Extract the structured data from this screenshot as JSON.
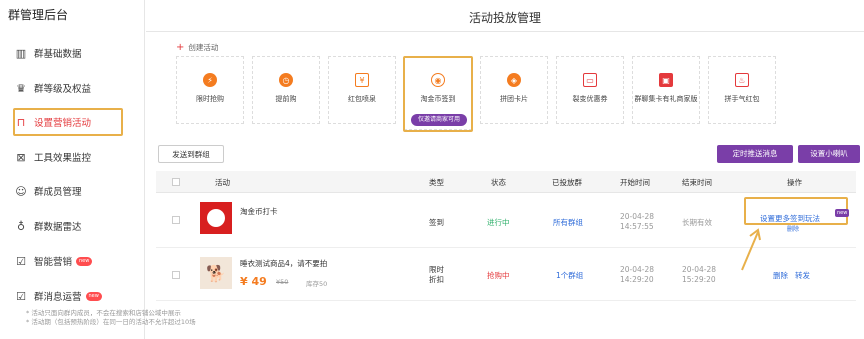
{
  "sidebar": {
    "title": "群管理后台",
    "items": [
      {
        "icon": "bar-chart-icon",
        "label": "群基础数据"
      },
      {
        "icon": "crown-icon",
        "label": "群等级及权益"
      },
      {
        "icon": "bag-icon",
        "label": "设置营销活动"
      },
      {
        "icon": "tool-icon",
        "label": "工具效果监控"
      },
      {
        "icon": "users-icon",
        "label": "群成员管理"
      },
      {
        "icon": "radar-icon",
        "label": "群数据雷达"
      },
      {
        "icon": "smart-icon",
        "label": "智能营销",
        "badge": "new"
      },
      {
        "icon": "message-icon",
        "label": "群消息运营",
        "badge": "new"
      }
    ]
  },
  "header": {
    "title": "活动投放管理"
  },
  "create": {
    "label": "创建活动"
  },
  "cards": [
    {
      "label": "限时抢购",
      "color": "#f47c20"
    },
    {
      "label": "提前购",
      "color": "#f47c20"
    },
    {
      "label": "红包喷泉",
      "color": "#f47c20"
    },
    {
      "label": "淘金币签到",
      "color": "#f47c20",
      "tip": "仅邀请商家可用"
    },
    {
      "label": "拼团卡片",
      "color": "#f47c20"
    },
    {
      "label": "裂变优惠券",
      "color": "#e4393c"
    },
    {
      "label": "群聊集卡有礼商家版",
      "color": "#e4393c"
    },
    {
      "label": "拼手气红包",
      "color": "#e4393c"
    }
  ],
  "buttons": {
    "send": "发送到群组",
    "scheduled": "定时推送消息",
    "settings": "设置小喇叭"
  },
  "table": {
    "headers": [
      "活动",
      "类型",
      "状态",
      "已投放群",
      "开始时间",
      "结束时间",
      "操作"
    ],
    "rows": [
      {
        "name": "淘金币打卡",
        "type": "签到",
        "status": "进行中",
        "groups": "所有群组",
        "start": "20-04-28\n14:57:55",
        "end": "长期有效",
        "op1": "设置更多签到玩法",
        "op1_badge": "new",
        "op2": "删除",
        "status_color": "#2aae67"
      },
      {
        "name": "睡衣测试商品4，请不要拍",
        "price": "¥ 49",
        "old_price": "¥50",
        "stock": "库存50",
        "type": "限时\n折扣",
        "status": "抢购中",
        "groups": "1个群组",
        "start": "20-04-28\n14:29:20",
        "end": "20-04-28\n15:29:20",
        "op1": "删除",
        "op2": "转发",
        "status_color": "#e4393c"
      }
    ]
  },
  "notes": [
    "* 活动只面向群内成员，不会在搜索和店铺公域中展示",
    "* 活动期（包括预热阶段）在同一日的活动不允许超过10场"
  ]
}
